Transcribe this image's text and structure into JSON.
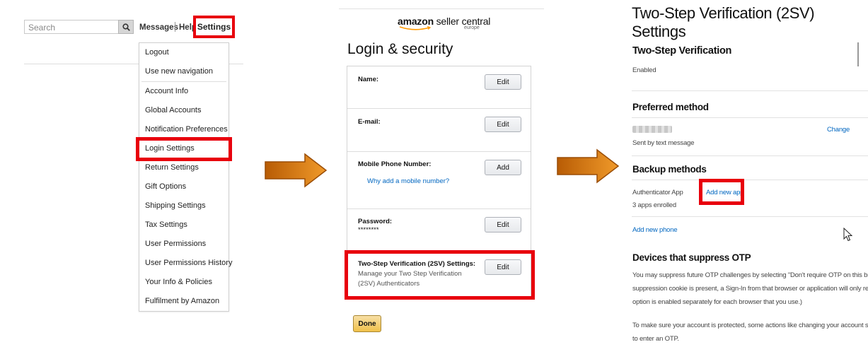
{
  "panel1": {
    "search_placeholder": "Search",
    "nav": {
      "messages": "Messages",
      "help": "Help",
      "settings": "Settings"
    },
    "menu": [
      "Logout",
      "Use new navigation",
      "Account Info",
      "Global Accounts",
      "Notification Preferences",
      "Login Settings",
      "Return Settings",
      "Gift Options",
      "Shipping Settings",
      "Tax Settings",
      "User Permissions",
      "User Permissions History",
      "Your Info & Policies",
      "Fulfilment by Amazon"
    ]
  },
  "panel2": {
    "logo_main": "amazon",
    "logo_rest": " seller central",
    "logo_sub": "europe",
    "title": "Login & security",
    "rows": {
      "name": {
        "label": "Name:",
        "button": "Edit"
      },
      "email": {
        "label": "E-mail:",
        "button": "Edit"
      },
      "mobile": {
        "label": "Mobile Phone Number:",
        "link": "Why add a mobile number?",
        "button": "Add"
      },
      "password": {
        "label": "Password:",
        "value": "********",
        "button": "Edit"
      },
      "twosv": {
        "label": "Two-Step Verification (2SV) Settings:",
        "desc_line1": "Manage your Two Step Verification",
        "desc_line2": "(2SV) Authenticators",
        "button": "Edit"
      }
    },
    "done": "Done"
  },
  "panel3": {
    "title": "Two-Step Verification (2SV) Settings",
    "section_2sv": {
      "heading": "Two-Step Verification",
      "status": "Enabled"
    },
    "preferred": {
      "heading": "Preferred method",
      "note": "Sent by text message",
      "change": "Change"
    },
    "backup": {
      "heading": "Backup methods",
      "auth_app": "Authenticator App",
      "enrolled": "3 apps enrolled",
      "add_app": "Add new app",
      "add_phone": "Add new phone"
    },
    "devices": {
      "heading": "Devices that suppress OTP",
      "lines": [
        "You may suppress future OTP challenges by selecting \"Don't require OTP on this browser\". As lo",
        "suppression cookie is present, a Sign-In from that browser or application will only require a pas",
        "option is enabled separately for each browser that you use.)"
      ],
      "lines2": [
        "To make sure your account is protected, some actions like changing your account security settin",
        "to enter an OTP."
      ]
    }
  },
  "colors": {
    "highlight_red": "#e8000c",
    "arrow_orange": "#d87a10",
    "link_blue": "#0066c0",
    "done_yellow": "#f0c14b"
  }
}
